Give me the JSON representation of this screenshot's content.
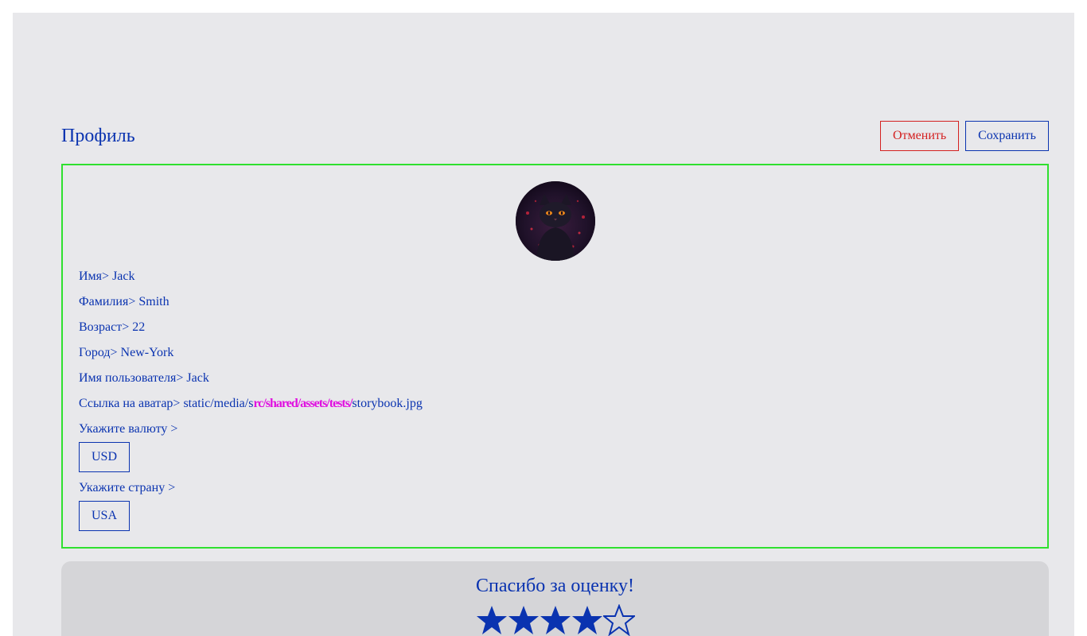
{
  "page": {
    "title": "Профиль"
  },
  "header": {
    "cancel_label": "Отменить",
    "save_label": "Сохранить"
  },
  "profile": {
    "avatar_alt": "cat-avatar",
    "fields": [
      {
        "label": "Имя>",
        "value": "Jack"
      },
      {
        "label": "Фамилия>",
        "value": "Smith"
      },
      {
        "label": "Возраст>",
        "value": "22"
      },
      {
        "label": "Город>",
        "value": "New-York"
      },
      {
        "label": "Имя пользователя>",
        "value": "Jack"
      },
      {
        "label": "Ссылка на аватар>",
        "value_prefix": "static/media/s",
        "value_overlay": "rc/shared/assets/tests/",
        "value_suffix": "storybook.jpg"
      }
    ],
    "currency": {
      "label": "Укажите валюту >",
      "value": "USD"
    },
    "country": {
      "label": "Укажите страну >",
      "value": "USA"
    }
  },
  "rating": {
    "title": "Спасибо за оценку!",
    "stars": 5
  },
  "colors": {
    "primary": "#0a33b0",
    "danger": "#d42020",
    "card_border": "#2fe02f",
    "background": "#e8e8eb",
    "overlay_text": "#e010e0"
  }
}
